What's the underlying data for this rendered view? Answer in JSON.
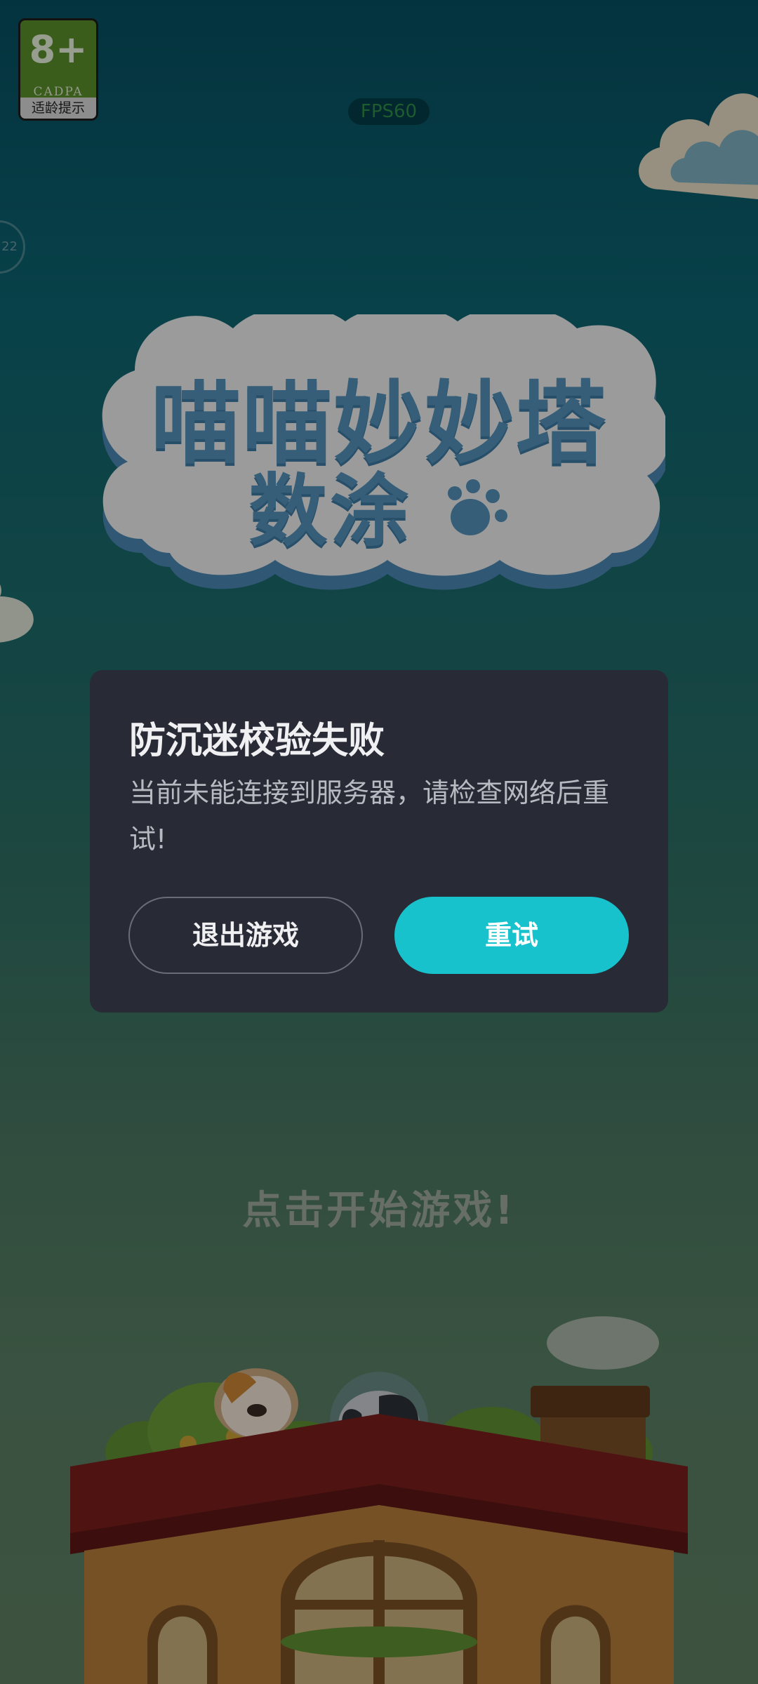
{
  "age_badge": {
    "rating": "8+",
    "org": "CADPA",
    "tip": "适龄提示",
    "color": "#5a8f2b"
  },
  "fps_label": "FPS60",
  "side_indicator": "22",
  "logo": {
    "line1": "喵喵妙妙塔",
    "line2": "数涂"
  },
  "tap_to_start": "点击开始游戏!",
  "dialog": {
    "title": "防沉迷校验失败",
    "message": "当前未能连接到服务器，请检查网络后重试!",
    "quit_label": "退出游戏",
    "retry_label": "重试",
    "accent_color": "#18c2cc"
  },
  "icons": {
    "logo_paw": "paw-icon",
    "cats": [
      "orange-cat",
      "grey-cat"
    ]
  }
}
